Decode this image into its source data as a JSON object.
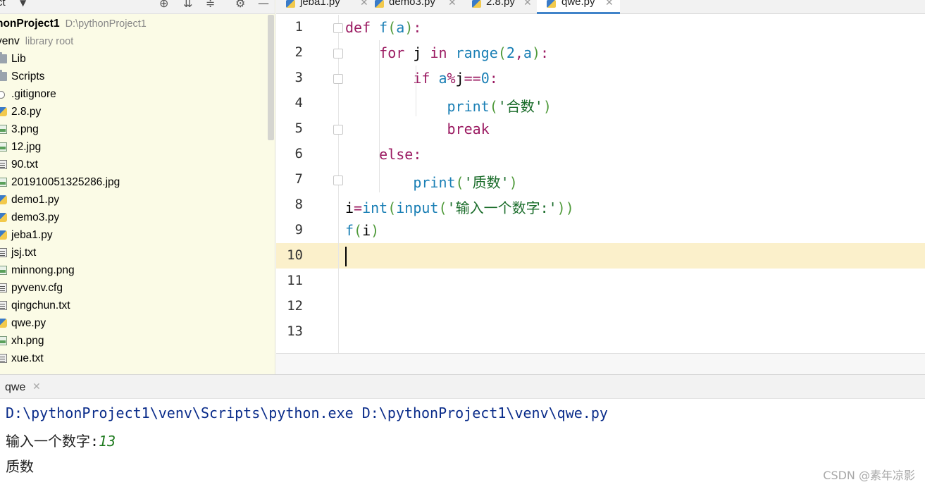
{
  "project_toolbar": {
    "title": "ct"
  },
  "project_tree": {
    "root": {
      "name": "honProject1",
      "path": "D:\\pythonProject1"
    },
    "venv": {
      "name": "venv",
      "hint": "library root"
    },
    "items": [
      {
        "name": "Lib",
        "icon": "folder-icon"
      },
      {
        "name": "Scripts",
        "icon": "folder-icon"
      },
      {
        "name": ".gitignore",
        "icon": "ignore-file-icon"
      },
      {
        "name": "2.8.py",
        "icon": "python-file-icon"
      },
      {
        "name": "3.png",
        "icon": "image-file-icon"
      },
      {
        "name": "12.jpg",
        "icon": "image-file-icon"
      },
      {
        "name": "90.txt",
        "icon": "text-file-icon"
      },
      {
        "name": "20191005132528​6.jpg",
        "icon": "image-file-icon"
      },
      {
        "name": "demo1.py",
        "icon": "python-file-icon"
      },
      {
        "name": "demo3.py",
        "icon": "python-file-icon"
      },
      {
        "name": "jeba1.py",
        "icon": "python-file-icon"
      },
      {
        "name": "jsj.txt",
        "icon": "text-file-icon"
      },
      {
        "name": "minnong.png",
        "icon": "image-file-icon"
      },
      {
        "name": "pyvenv.cfg",
        "icon": "text-file-icon"
      },
      {
        "name": "qingchun.txt",
        "icon": "text-file-icon"
      },
      {
        "name": "qwe.py",
        "icon": "python-file-icon"
      },
      {
        "name": "xh.png",
        "icon": "image-file-icon"
      },
      {
        "name": "xue.txt",
        "icon": "text-file-icon"
      }
    ]
  },
  "editor_tabs": [
    {
      "label": "jeba1.py",
      "active": false
    },
    {
      "label": "demo3.py",
      "active": false
    },
    {
      "label": "2.8.py",
      "active": false
    },
    {
      "label": "qwe.py",
      "active": true
    }
  ],
  "code": {
    "current_line": 10,
    "lines": [
      {
        "n": "1",
        "tokens": [
          [
            "kw",
            "def "
          ],
          [
            "fn",
            "f"
          ],
          [
            "par",
            "("
          ],
          [
            "fn",
            "a"
          ],
          [
            "par",
            ")"
          ],
          [
            "kw",
            ":"
          ]
        ]
      },
      {
        "n": "2",
        "tokens": [
          [
            "",
            "    "
          ],
          [
            "kw",
            "for "
          ],
          [
            "",
            "j "
          ],
          [
            "kw",
            "in "
          ],
          [
            "fn",
            "range"
          ],
          [
            "par",
            "("
          ],
          [
            "num",
            "2"
          ],
          [
            "kw",
            ","
          ],
          [
            "fn",
            "a"
          ],
          [
            "par",
            ")"
          ],
          [
            "kw",
            ":"
          ]
        ]
      },
      {
        "n": "3",
        "tokens": [
          [
            "",
            "        "
          ],
          [
            "kw",
            "if "
          ],
          [
            "fn",
            "a"
          ],
          [
            "kw",
            "%"
          ],
          [
            "",
            "j"
          ],
          [
            "kw",
            "=="
          ],
          [
            "num",
            "0"
          ],
          [
            "kw",
            ":"
          ]
        ]
      },
      {
        "n": "4",
        "tokens": [
          [
            "",
            "            "
          ],
          [
            "fn",
            "print"
          ],
          [
            "par",
            "("
          ],
          [
            "str",
            "'合数'"
          ],
          [
            "par",
            ")"
          ]
        ]
      },
      {
        "n": "5",
        "tokens": [
          [
            "",
            "            "
          ],
          [
            "kw",
            "break"
          ]
        ]
      },
      {
        "n": "6",
        "tokens": [
          [
            "",
            "    "
          ],
          [
            "kw",
            "else:"
          ]
        ]
      },
      {
        "n": "7",
        "tokens": [
          [
            "",
            "        "
          ],
          [
            "fn",
            "print"
          ],
          [
            "par",
            "("
          ],
          [
            "str",
            "'质数'"
          ],
          [
            "par",
            ")"
          ]
        ]
      },
      {
        "n": "8",
        "tokens": [
          [
            "",
            "i"
          ],
          [
            "kw",
            "="
          ],
          [
            "fn",
            "int"
          ],
          [
            "par",
            "("
          ],
          [
            "fn",
            "input"
          ],
          [
            "par",
            "("
          ],
          [
            "str",
            "'输入一个数字:'"
          ],
          [
            "par",
            "))"
          ]
        ]
      },
      {
        "n": "9",
        "tokens": [
          [
            "fn",
            "f"
          ],
          [
            "par",
            "("
          ],
          [
            "",
            "i"
          ],
          [
            "par",
            ")"
          ]
        ]
      },
      {
        "n": "10",
        "tokens": []
      },
      {
        "n": "11",
        "tokens": []
      },
      {
        "n": "12",
        "tokens": []
      },
      {
        "n": "13",
        "tokens": []
      }
    ]
  },
  "run_panel": {
    "tab_label": "qwe",
    "command": "D:\\pythonProject1\\venv\\Scripts\\python.exe D:\\pythonProject1\\venv\\qwe.py",
    "prompt": "输入一个数字:",
    "user_input": "13",
    "output": "质数"
  },
  "watermark": "CSDN @素年凉影",
  "colors": {
    "project_bg": "#fbfbe6",
    "current_line": "#fbf0cb",
    "keyword": "#9b1b62",
    "function": "#1a7fb5",
    "string": "#1a6c2a",
    "console_cmd": "#0a2c8a",
    "console_input": "#1e7a1e",
    "active_tab_underline": "#4083c9"
  }
}
